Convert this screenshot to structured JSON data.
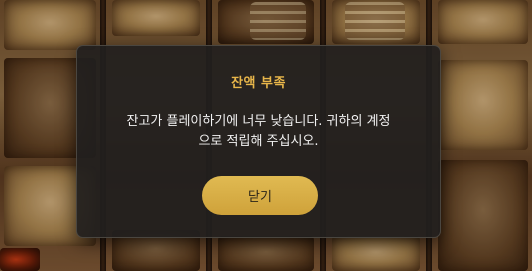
{
  "dialog": {
    "title": "잔액 부족",
    "message_line1": "잔고가 플레이하기에 너무 낮습니다. 귀하의 계정",
    "message_line2": "으로 적립해 주십시오.",
    "close_label": "닫기"
  },
  "colors": {
    "title": "#e8b64a",
    "button": "#d9ae45",
    "dialog_bg": "#211f1e"
  }
}
